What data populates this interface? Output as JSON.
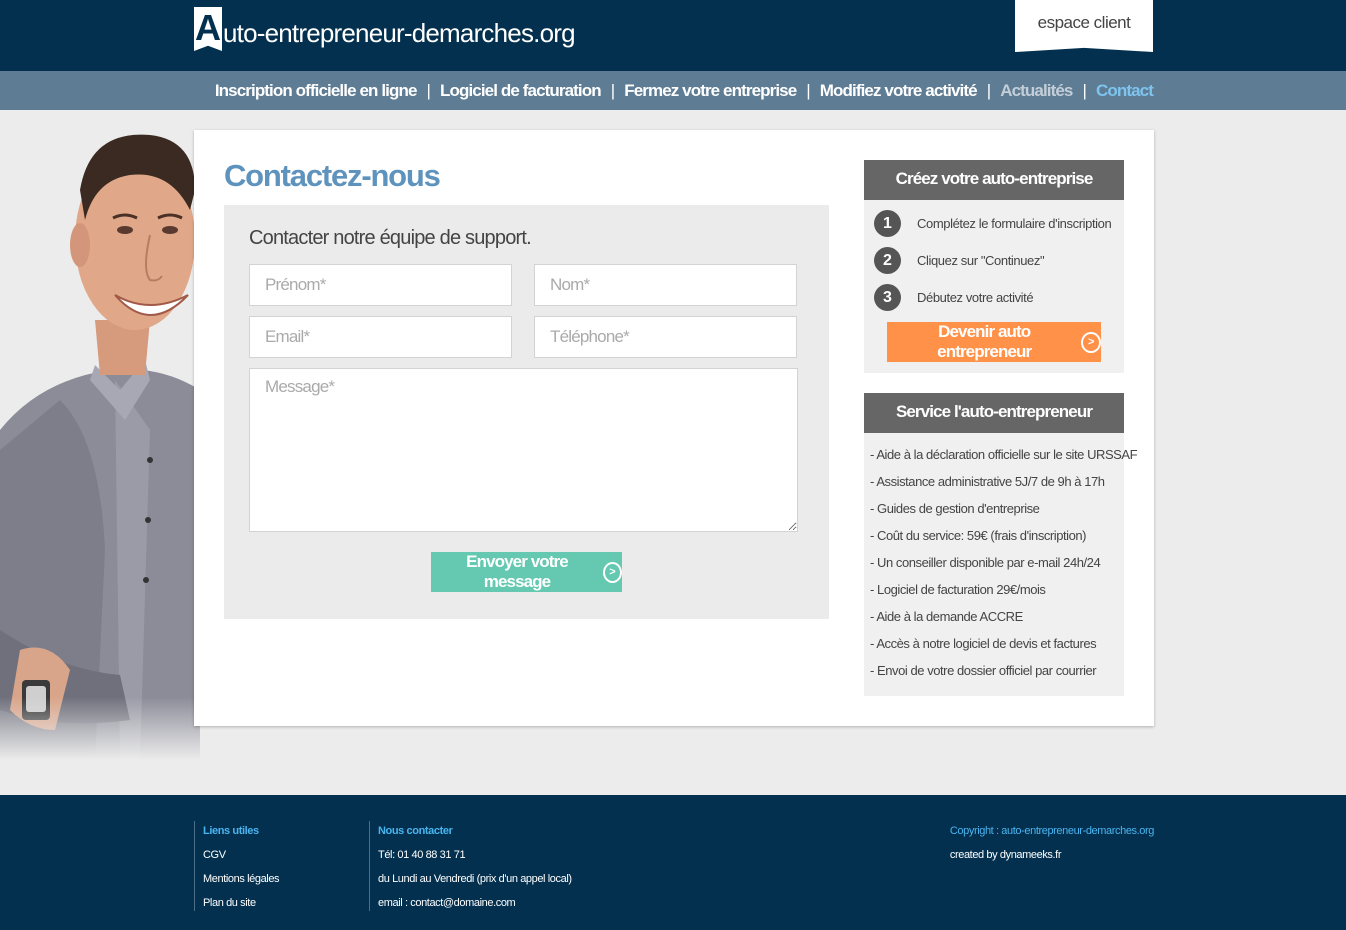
{
  "header": {
    "logo_letter": "A",
    "logo_rest": "uto-entrepreneur-demarches.org",
    "espace_client": "espace client"
  },
  "nav": {
    "items": [
      "Inscription officielle en ligne",
      "Logiciel de facturation",
      "Fermez votre entreprise",
      "Modifiez votre activité",
      "Actualités",
      "Contact"
    ],
    "separator": "|"
  },
  "main": {
    "title": "Contactez-nous",
    "form": {
      "heading": "Contacter notre équipe de support.",
      "firstname_placeholder": "Prénom*",
      "lastname_placeholder": "Nom*",
      "email_placeholder": "Email*",
      "phone_placeholder": "Téléphone*",
      "message_placeholder": "Message*",
      "submit_label": "Envoyer votre message",
      "arrow": ">"
    }
  },
  "sidebar": {
    "create": {
      "title": "Créez votre auto-entreprise",
      "steps": [
        {
          "num": "1",
          "text": "Complétez le formulaire d'inscription"
        },
        {
          "num": "2",
          "text": "Cliquez sur \"Continuez\""
        },
        {
          "num": "3",
          "text": "Débutez votre activité"
        }
      ],
      "cta_label": "Devenir auto entrepreneur",
      "arrow": ">"
    },
    "service": {
      "title": "Service l'auto-entrepreneur",
      "items": [
        "- Aide à la déclaration officielle sur le site URSSAF",
        "- Assistance administrative 5J/7 de 9h à 17h",
        "- Guides de gestion d'entreprise",
        "- Coût du service: 59€ (frais d'inscription)",
        "- Un conseiller disponible par e-mail 24h/24",
        "- Logiciel de facturation 29€/mois",
        "- Aide à la demande ACCRE",
        "- Accès à notre logiciel de devis et factures",
        "- Envoi de votre dossier officiel par courrier"
      ]
    }
  },
  "footer": {
    "links_title": "Liens utiles",
    "links": [
      "CGV",
      "Mentions légales",
      "Plan du site"
    ],
    "contact_title": "Nous contacter",
    "contact_lines": [
      "Tél: 01 40 88 31 71",
      "du Lundi au Vendredi (prix d'un appel local)",
      "email : contact@domaine.com"
    ],
    "copyright": "Copyright : auto-entrepreneur-demarches.org",
    "created_by": "created by dynameeks.fr"
  },
  "colors": {
    "header_bg": "#03304f",
    "nav_bg": "#5e7c93",
    "title_blue": "#5e93bd",
    "send_button": "#64c9b0",
    "cta_orange": "#ff9248",
    "active_link": "#7ec4ef"
  }
}
